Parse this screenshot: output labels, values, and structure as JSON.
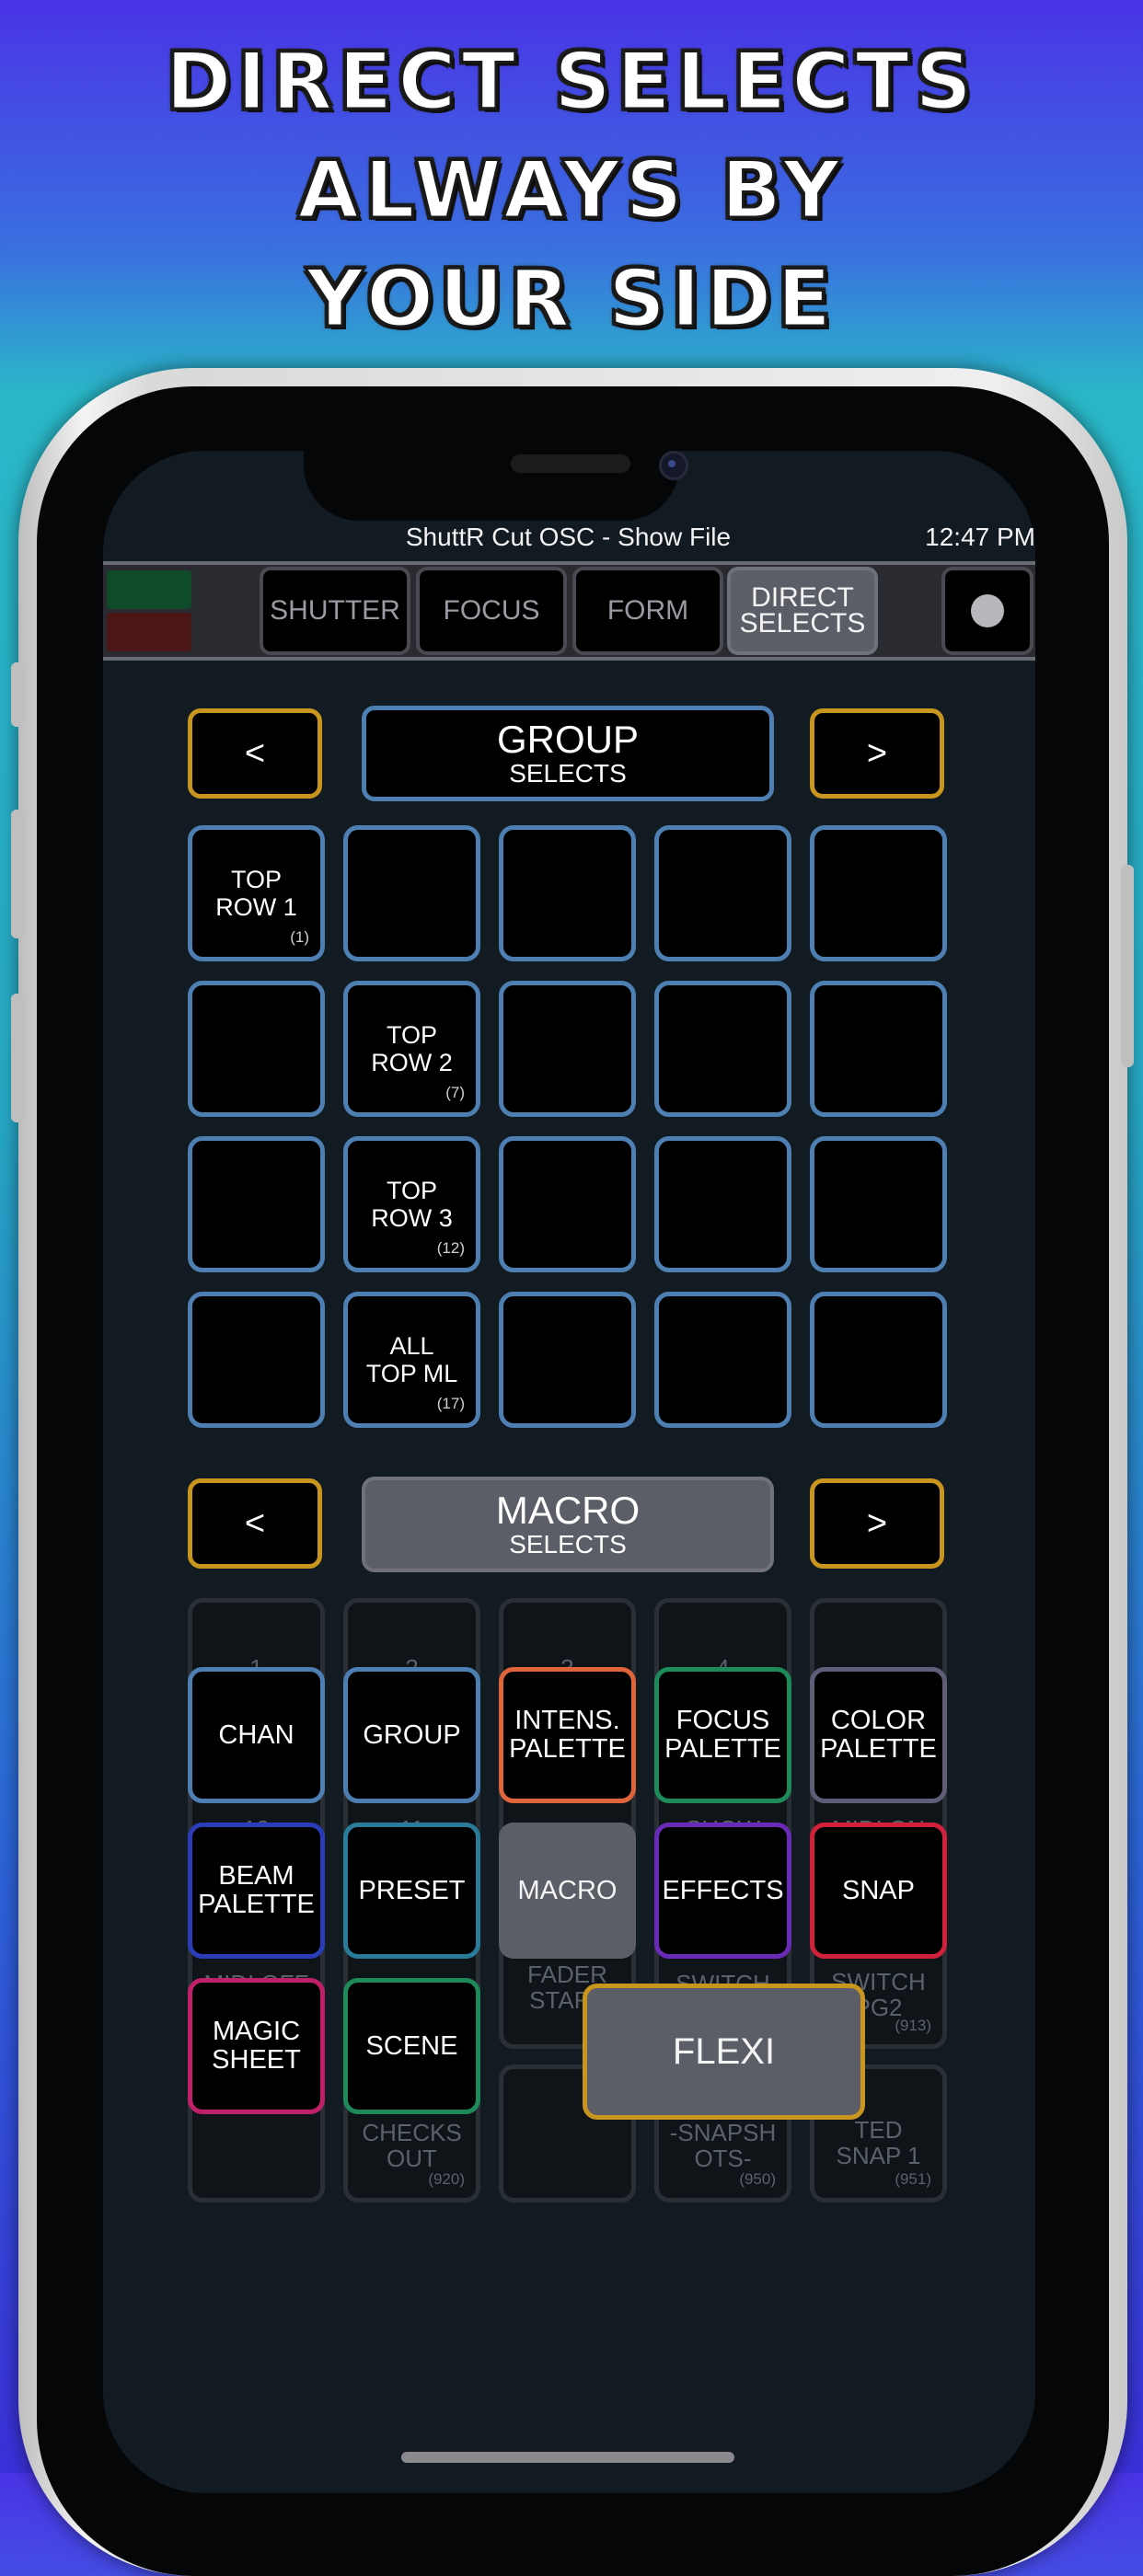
{
  "headline": [
    "DIRECT SELECTS",
    "ALWAYS BY",
    "YOUR SIDE"
  ],
  "status": {
    "title": "ShuttR Cut OSC - Show File",
    "time": "12:47 PM"
  },
  "indicators": {
    "top_color": "#0f4a2a",
    "bottom_color": "#4a1616"
  },
  "tabs": [
    {
      "label": "SHUTTER",
      "active": false
    },
    {
      "label": "FOCUS",
      "active": false
    },
    {
      "label": "FORM",
      "active": false
    },
    {
      "label": "DIRECT\nSELECTS",
      "active": true
    }
  ],
  "group_section": {
    "prev": "<",
    "next": ">",
    "title": "GROUP",
    "subtitle": "SELECTS",
    "cells": [
      [
        "TOP\nROW 1",
        "(1)"
      ],
      [
        "",
        ""
      ],
      [
        "",
        ""
      ],
      [
        "",
        ""
      ],
      [
        "",
        ""
      ],
      [
        "",
        ""
      ],
      [
        "TOP\nROW 2",
        "(7)"
      ],
      [
        "",
        ""
      ],
      [
        "",
        ""
      ],
      [
        "",
        ""
      ],
      [
        "",
        ""
      ],
      [
        "TOP\nROW 3",
        "(12)"
      ],
      [
        "",
        ""
      ],
      [
        "",
        ""
      ],
      [
        "",
        ""
      ],
      [
        "",
        ""
      ],
      [
        "ALL\nTOP ML",
        "(17)"
      ],
      [
        "",
        ""
      ],
      [
        "",
        ""
      ],
      [
        "",
        ""
      ]
    ]
  },
  "macro_section": {
    "prev": "<",
    "next": ">",
    "title": "MACRO",
    "subtitle": "SELECTS",
    "bg_cells": {
      "c1": "1",
      "c2": "2",
      "c3": "3",
      "c4": "4",
      "r2c1": "10",
      "r2c2": "11",
      "r2c4": "SHOW",
      "r2c5": "MIDI ON",
      "r3c1": "MIDI OFF",
      "r3c3": "FADER\nSTART",
      "r3c4": "SWITCH",
      "r3c5": "SWITCH\nPG2",
      "r3c5_num": "(913)",
      "r4c2": "CHECKS\nOUT",
      "r4c2_num": "(920)",
      "r4c4": "-SNAPSH\nOTS-",
      "r4c4_num": "(950)",
      "r4c5": "TED\nSNAP 1",
      "r4c5_num": "(951)"
    }
  },
  "flexi_menu": {
    "items": [
      {
        "label": "CHAN",
        "color": "#4e7fb3"
      },
      {
        "label": "GROUP",
        "color": "#4e7fb3"
      },
      {
        "label": "INTENS.\nPALETTE",
        "color": "#e0643a"
      },
      {
        "label": "FOCUS\nPALETTE",
        "color": "#1e8a5a"
      },
      {
        "label": "COLOR\nPALETTE",
        "color": "#5e5e78"
      },
      {
        "label": "BEAM\nPALETTE",
        "color": "#2a3cb8"
      },
      {
        "label": "PRESET",
        "color": "#2a7a9a"
      },
      {
        "label": "MACRO",
        "color": "#5b5e66"
      },
      {
        "label": "EFFECTS",
        "color": "#6a2ab8"
      },
      {
        "label": "SNAP",
        "color": "#d0203a"
      },
      {
        "label": "MAGIC\nSHEET",
        "color": "#c0206a"
      },
      {
        "label": "SCENE",
        "color": "#1e8a5a"
      }
    ],
    "flexi_label": "FLEXI"
  }
}
